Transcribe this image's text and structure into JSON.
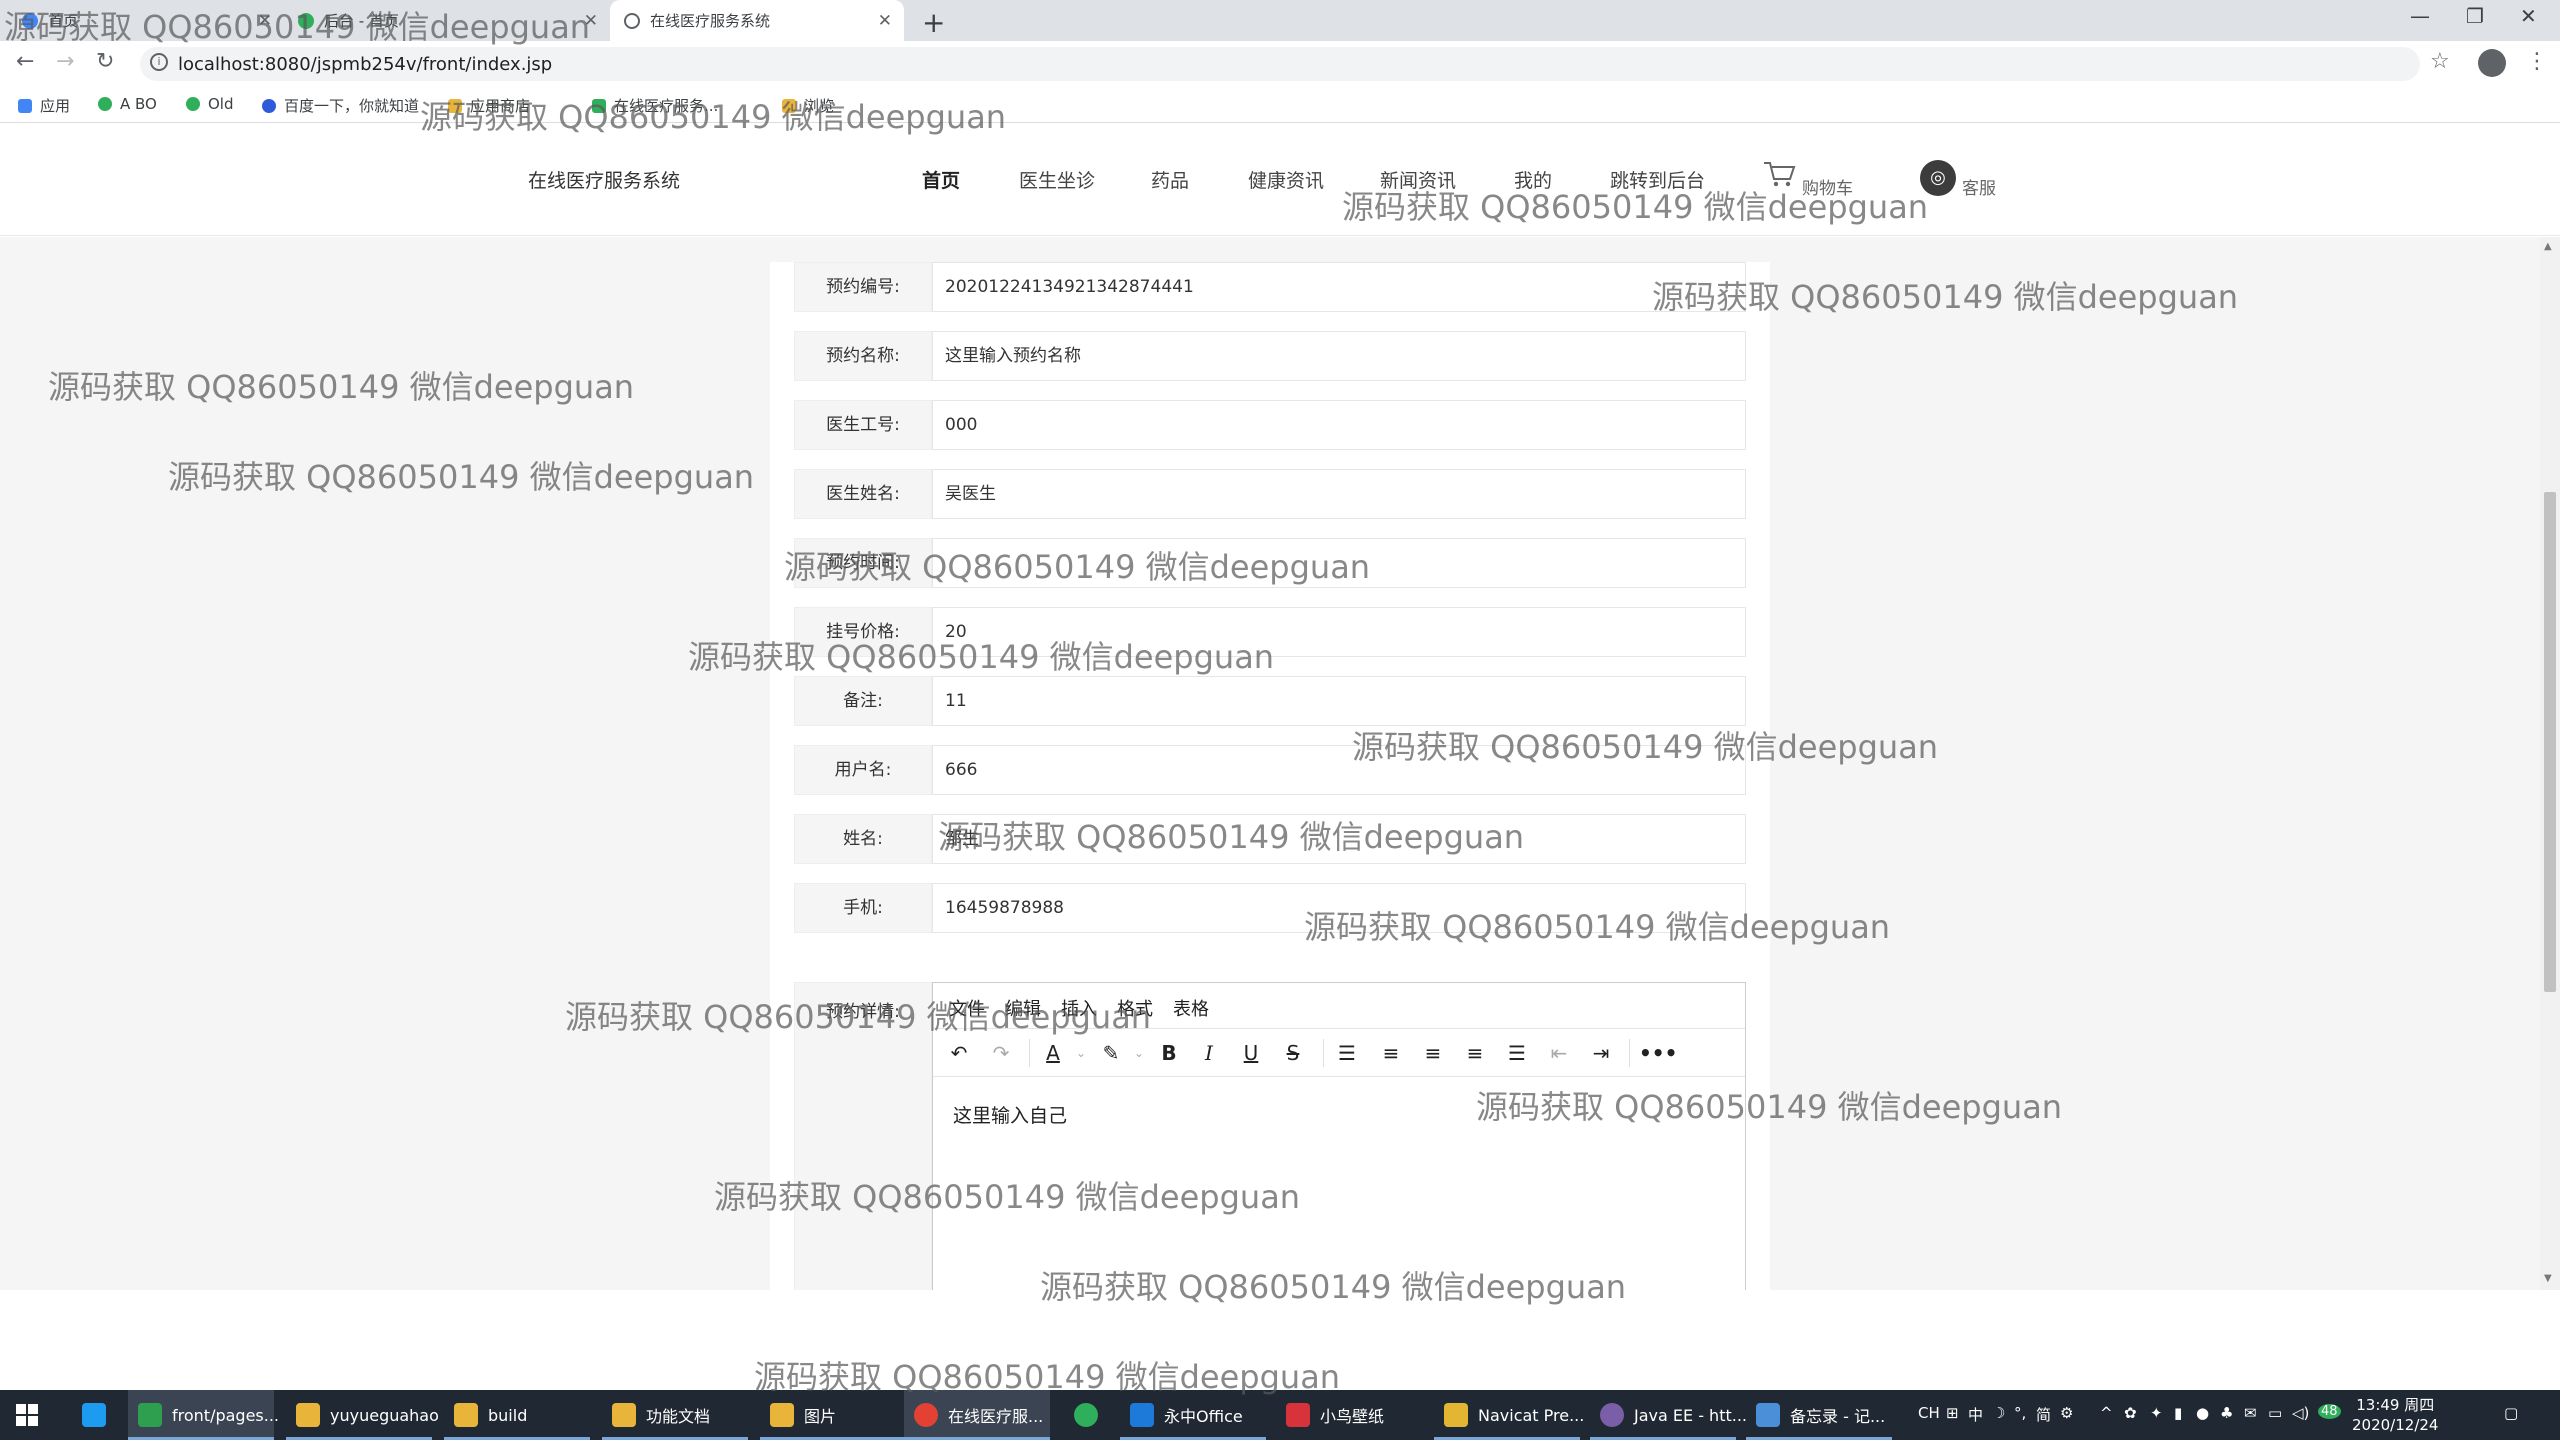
{
  "browser": {
    "tabs": [
      {
        "title": "首页",
        "active": false
      },
      {
        "title": "后台 - 首页",
        "active": false
      },
      {
        "title": "在线医疗服务系统",
        "active": true
      }
    ],
    "new_tab_icon": "plus-icon",
    "url": "localhost:8080/jspmb254v/front/index.jsp",
    "bookmarks": [
      "应用",
      "A BO",
      "Old",
      "百度一下，你就知道",
      "应用商店",
      "在线医疗服务...",
      "浏览"
    ]
  },
  "site": {
    "title": "在线医疗服务系统",
    "nav": [
      "首页",
      "医生坐诊",
      "药品",
      "健康资讯",
      "新闻资讯",
      "我的",
      "跳转到后台"
    ],
    "cart_label": "购物车",
    "service_label": "客服"
  },
  "form": {
    "fields": [
      {
        "label": "预约编号:",
        "value": "20201224134921342874441"
      },
      {
        "label": "预约名称:",
        "value": "这里输入预约名称"
      },
      {
        "label": "医生工号:",
        "value": "000"
      },
      {
        "label": "医生姓名:",
        "value": "吴医生"
      },
      {
        "label": "预约时间:",
        "value": ""
      },
      {
        "label": "挂号价格:",
        "value": "20"
      },
      {
        "label": "备注:",
        "value": "11"
      },
      {
        "label": "用户名:",
        "value": "666"
      },
      {
        "label": "姓名:",
        "value": "邹生"
      },
      {
        "label": "手机:",
        "value": "16459878988"
      }
    ],
    "editor": {
      "label": "预约详情:",
      "menu": [
        "文件",
        "编辑",
        "插入",
        "格式",
        "表格"
      ],
      "content": "这里输入自己"
    }
  },
  "taskbar": {
    "apps": [
      {
        "label": "front/pages...",
        "color": "#2e9e4f"
      },
      {
        "label": "yuyueguahao",
        "color": "#e8b43a"
      },
      {
        "label": "build",
        "color": "#e8b43a"
      },
      {
        "label": "功能文档",
        "color": "#e8b43a"
      },
      {
        "label": "图片",
        "color": "#e8b43a"
      },
      {
        "label": "在线医疗服...",
        "color": "#e34133"
      },
      {
        "label": "",
        "color": "#2fae5c"
      },
      {
        "label": "永中Office",
        "color": "#1d7ad8"
      },
      {
        "label": "小鸟壁纸",
        "color": "#d8333a"
      },
      {
        "label": "Navicat Pre...",
        "color": "#e2b533"
      },
      {
        "label": "Java EE - htt...",
        "color": "#7a5fa8"
      },
      {
        "label": "备忘录 - 记...",
        "color": "#4a8fd8"
      }
    ],
    "tray_ime": "中",
    "tray_ime2": "简",
    "time": "13:49 周四",
    "date": "2020/12/24",
    "badge": "48"
  },
  "watermark": "源码获取 QQ86050149 微信deepguan"
}
